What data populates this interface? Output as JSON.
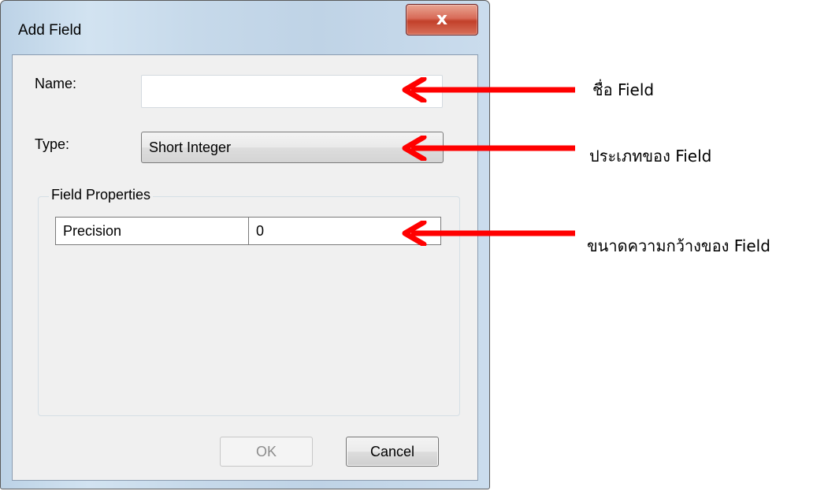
{
  "dialog": {
    "title": "Add Field",
    "close_glyph": "x",
    "name_label": "Name:",
    "name_value": "",
    "type_label": "Type:",
    "type_value": "Short Integer",
    "group_label": "Field Properties",
    "properties": [
      {
        "key": "Precision",
        "value": "0"
      }
    ],
    "ok_label": "OK",
    "cancel_label": "Cancel",
    "ok_enabled": false
  },
  "annotations": [
    {
      "text": "ชื่อ Field"
    },
    {
      "text": "ประเภทของ Field"
    },
    {
      "text": "ขนาดความกว้างของ Field"
    }
  ],
  "colors": {
    "arrow": "#ff0000",
    "close_button": "#c7432d",
    "dialog_frame": "#c6d9ea",
    "client_bg": "#f0f0f0"
  },
  "icons": {
    "close": "close-icon",
    "arrow": "arrow-left-icon"
  }
}
